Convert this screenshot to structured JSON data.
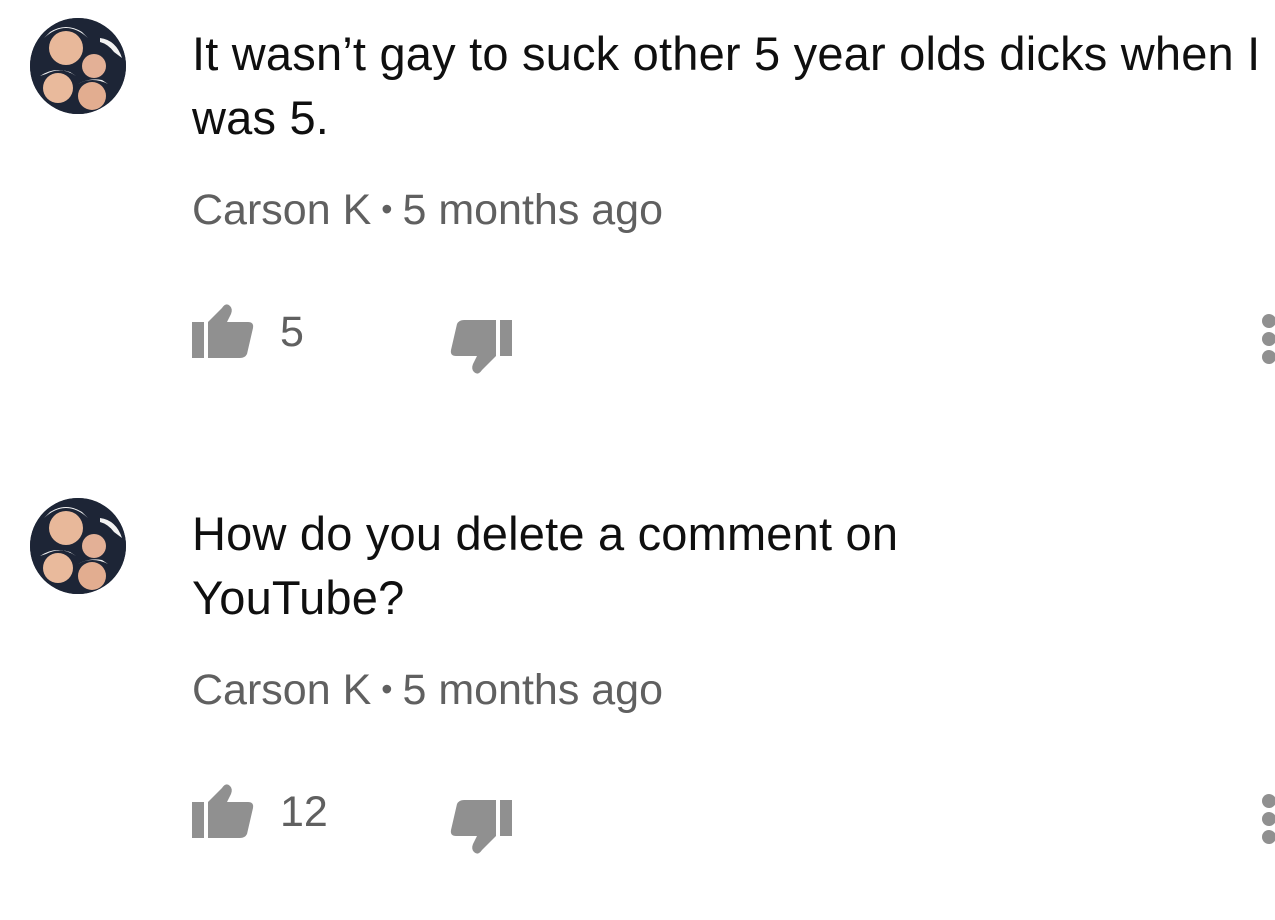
{
  "comments": [
    {
      "text": "It wasn’t gay to suck other 5 year olds dicks when I was 5.",
      "author": "Carson K",
      "separator": "•",
      "time": "5 months ago",
      "likes": "5"
    },
    {
      "text": "How do you delete a comment on YouTube?",
      "author": "Carson K",
      "separator": "•",
      "time": "5 months ago",
      "likes": "12"
    }
  ],
  "icons": {
    "like": "thumbs-up-icon",
    "dislike": "thumbs-down-icon",
    "more": "more-vertical-icon"
  },
  "colors": {
    "text": "#0f0f0f",
    "meta": "#606060",
    "icon": "#909090"
  }
}
